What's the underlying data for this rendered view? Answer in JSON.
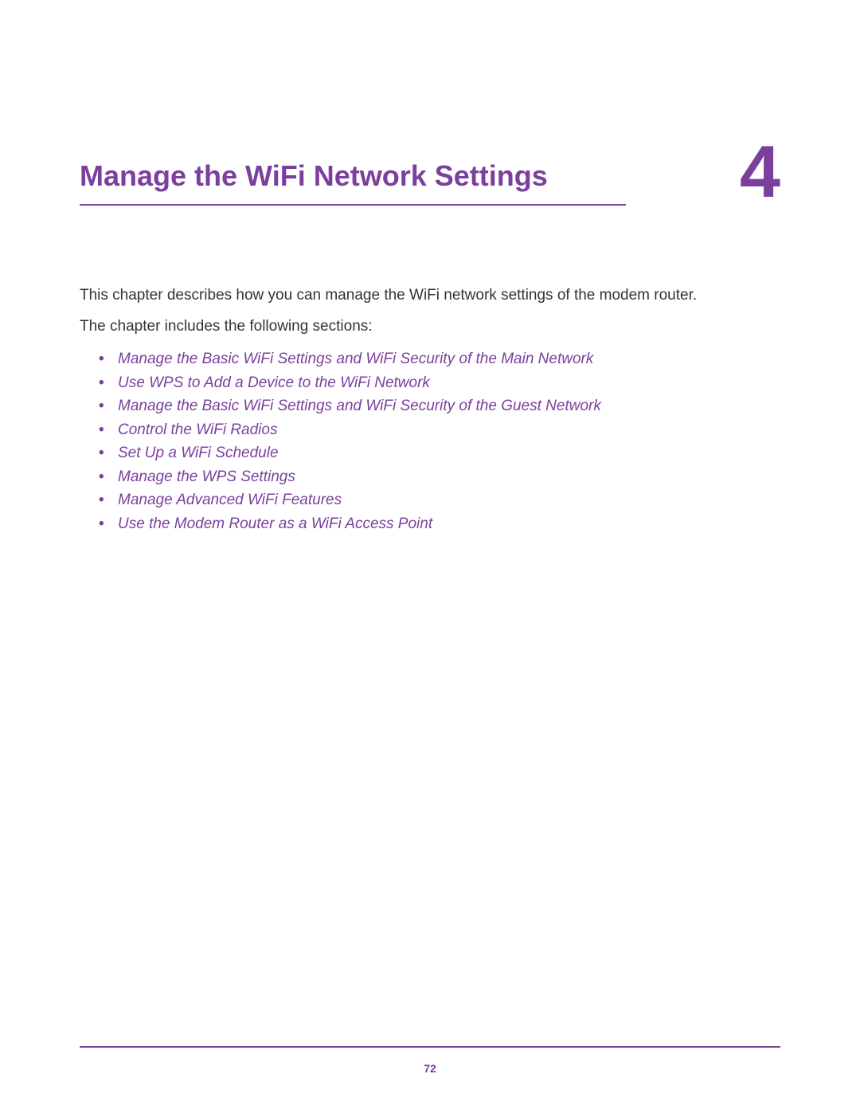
{
  "chapter": {
    "title": "Manage the WiFi Network Settings",
    "number": "4"
  },
  "intro": "This chapter describes how you can manage the WiFi network settings of the modem router.",
  "sectionsIntro": "The chapter includes the following sections:",
  "sections": [
    "Manage the Basic WiFi Settings and WiFi Security of the Main Network",
    "Use WPS to Add a Device to the WiFi Network",
    "Manage the Basic WiFi Settings and WiFi Security of the Guest Network",
    "Control the WiFi Radios",
    "Set Up a WiFi Schedule",
    "Manage the WPS Settings",
    "Manage Advanced WiFi Features",
    "Use the Modem Router as a WiFi Access Point"
  ],
  "pageNumber": "72"
}
